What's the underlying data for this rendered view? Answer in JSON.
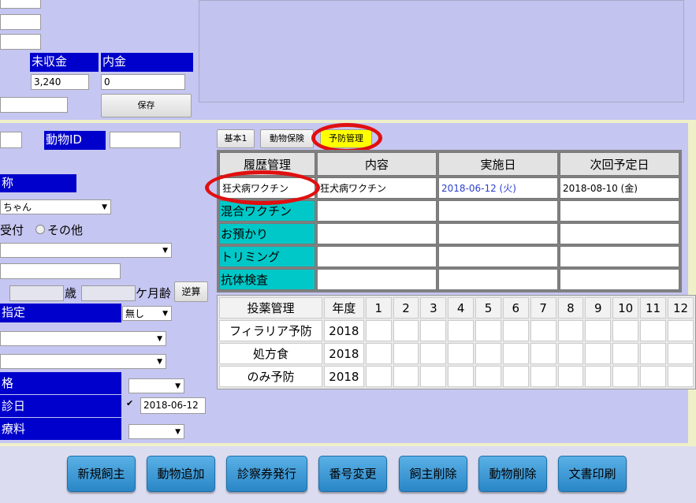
{
  "top_form": {
    "uncollected_label": "未収金",
    "uncollected_value": "3,240",
    "deposit_label": "内金",
    "deposit_value": "0",
    "save_button": "保存"
  },
  "animal_form": {
    "animal_id_label": "動物ID",
    "animal_id_value": "",
    "name_label_partial": "称",
    "pet_select_value": "ちゃん",
    "reception_radio_label": "受付",
    "other_radio_label": "その他",
    "age_years_suffix": "歳",
    "age_months_suffix": "ケ月齢",
    "reverse_calc_button": "逆算",
    "designation_label_partial": "指定",
    "designation_select_value": "無し",
    "price_label_partial": "格",
    "visit_date_label_partial": "診日",
    "visit_date_value": "2018-06-12",
    "fee_label_partial": "療料"
  },
  "tabs": {
    "basic": "基本1",
    "insurance": "動物保険",
    "prevention": "予防管理"
  },
  "history_table": {
    "headers": [
      "履歴管理",
      "内容",
      "実施日",
      "次回予定日"
    ],
    "rows": [
      {
        "label": "狂犬病ワクチン",
        "content": "狂犬病ワクチン",
        "date": "2018-06-12 (火)",
        "next": "2018-08-10 (金)"
      },
      {
        "label": "混合ワクチン",
        "content": "",
        "date": "",
        "next": ""
      },
      {
        "label": "お預かり",
        "content": "",
        "date": "",
        "next": ""
      },
      {
        "label": "トリミング",
        "content": "",
        "date": "",
        "next": ""
      },
      {
        "label": "抗体検査",
        "content": "",
        "date": "",
        "next": ""
      }
    ]
  },
  "meds_table": {
    "headers": [
      "投薬管理",
      "年度",
      "1",
      "2",
      "3",
      "4",
      "5",
      "6",
      "7",
      "8",
      "9",
      "10",
      "11",
      "12"
    ],
    "rows": [
      {
        "label": "フィラリア予防",
        "year": "2018"
      },
      {
        "label": "処方食",
        "year": "2018"
      },
      {
        "label": "のみ予防",
        "year": "2018"
      }
    ]
  },
  "bottom_buttons": [
    "新規飼主",
    "動物追加",
    "診察券発行",
    "番号変更",
    "飼主削除",
    "動物削除",
    "文書印刷"
  ],
  "colors": {
    "label_blue": "#0000cc",
    "row_cyan": "#00c8c8",
    "highlight_yellow": "#ffff00",
    "annotation_red": "#e01010"
  }
}
